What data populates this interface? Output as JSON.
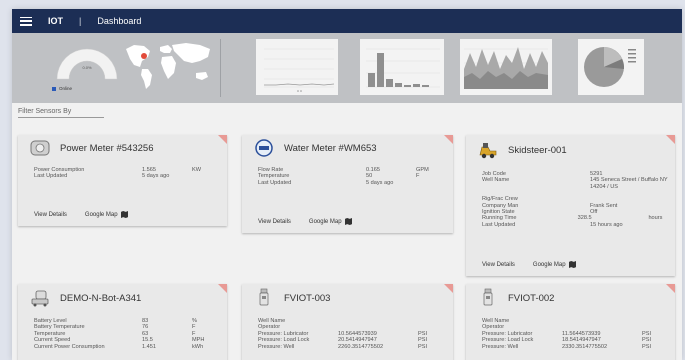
{
  "header": {
    "app_name": "IOT",
    "separator": "|",
    "page_title": "Dashboard"
  },
  "banner": {
    "gauge_value": "0.0%",
    "online_label": "Online"
  },
  "filter": {
    "label": "Filter Sensors By"
  },
  "actions": {
    "view_details": "View Details",
    "google_map": "Google Map"
  },
  "cards": [
    {
      "title": "Power Meter #543256",
      "icon": "power-meter-icon",
      "rows": [
        {
          "k": "Power Consumption",
          "v": "1.565",
          "u": "KW"
        },
        {
          "k": "Last Updated",
          "v": "5 days ago",
          "u": ""
        }
      ]
    },
    {
      "title": "Water Meter #WM653",
      "icon": "water-meter-icon",
      "rows": [
        {
          "k": "Flow Rate",
          "v": "0.165",
          "u": "GPM"
        },
        {
          "k": "Temperature",
          "v": "50",
          "u": "F"
        },
        {
          "k": "Last Updated",
          "v": "5 days ago",
          "u": ""
        }
      ]
    },
    {
      "title": "Skidsteer-001",
      "icon": "skidsteer-icon",
      "rows": [
        {
          "k": "Job Code",
          "v": "5291",
          "u": ""
        },
        {
          "k": "Well Name",
          "v": "145 Seneca Street / Buffalo NY 14204 / US",
          "u": ""
        },
        {
          "k": "Rig/Frac Crew",
          "v": "",
          "u": ""
        },
        {
          "k": "Company Man",
          "v": "Frank Sent",
          "u": ""
        },
        {
          "k": "Ignition State",
          "v": "Off",
          "u": ""
        },
        {
          "k": "Running Time",
          "v": "328.5",
          "u": "hours"
        },
        {
          "k": "Last Updated",
          "v": "15 hours ago",
          "u": ""
        }
      ]
    },
    {
      "title": "DEMO-N-Bot-A341",
      "icon": "robot-icon",
      "rows": [
        {
          "k": "Battery Level",
          "v": "83",
          "u": "%"
        },
        {
          "k": "Battery Temperature",
          "v": "76",
          "u": "F"
        },
        {
          "k": "Temperature",
          "v": "63",
          "u": "F"
        },
        {
          "k": "Current Speed",
          "v": "15.5",
          "u": "MPH"
        },
        {
          "k": "Current Power Consumption",
          "v": "1.451",
          "u": "kWh"
        }
      ]
    },
    {
      "title": "FVIOT-003",
      "icon": "sensor-device-icon",
      "rows": [
        {
          "k": "Well Name",
          "v": "",
          "u": ""
        },
        {
          "k": "Operator",
          "v": "",
          "u": ""
        },
        {
          "k": "Pressure: Lubricator",
          "v": "10.5644573939",
          "u": "PSI"
        },
        {
          "k": "Pressure: Load Lock",
          "v": "20.5414947947",
          "u": "PSI"
        },
        {
          "k": "Pressure: Well",
          "v": "2260.3514775502",
          "u": "PSI"
        }
      ]
    },
    {
      "title": "FVIOT-002",
      "icon": "sensor-device-icon",
      "rows": [
        {
          "k": "Well Name",
          "v": "",
          "u": ""
        },
        {
          "k": "Operator",
          "v": "",
          "u": ""
        },
        {
          "k": "Pressure: Lubricator",
          "v": "11.5644573939",
          "u": "PSI"
        },
        {
          "k": "Pressure: Load Lock",
          "v": "18.5414947947",
          "u": "PSI"
        },
        {
          "k": "Pressure: Well",
          "v": "2330.3514775502",
          "u": "PSI"
        }
      ]
    }
  ]
}
